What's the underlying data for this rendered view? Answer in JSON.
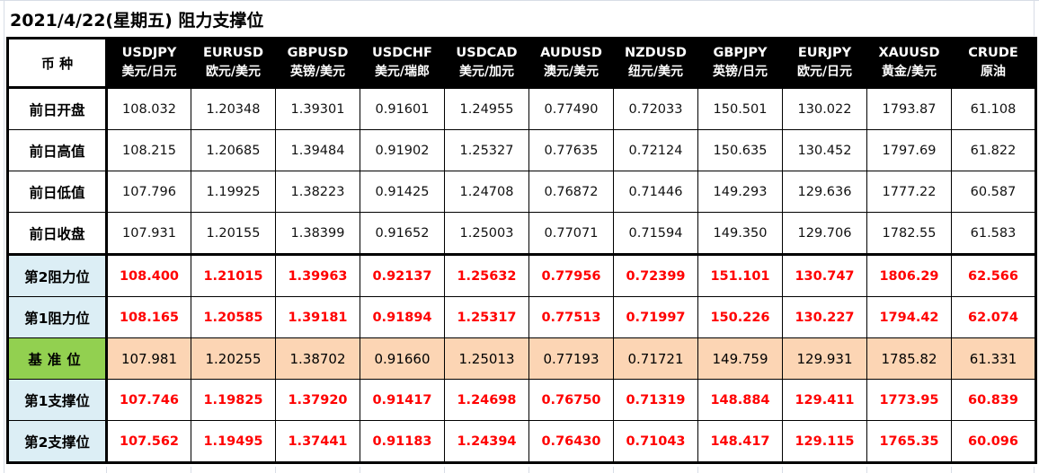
{
  "title": "2021/4/22(星期五) 阻力支撑位",
  "corner_label": "币 种",
  "columns": [
    {
      "code": "USDJPY",
      "name": "美元/日元"
    },
    {
      "code": "EURUSD",
      "name": "欧元/美元"
    },
    {
      "code": "GBPUSD",
      "name": "英镑/美元"
    },
    {
      "code": "USDCHF",
      "name": "美元/瑞郎"
    },
    {
      "code": "USDCAD",
      "name": "美元/加元"
    },
    {
      "code": "AUDUSD",
      "name": "澳元/美元"
    },
    {
      "code": "NZDUSD",
      "name": "纽元/美元"
    },
    {
      "code": "GBPJPY",
      "name": "英镑/日元"
    },
    {
      "code": "EURJPY",
      "name": "欧元/日元"
    },
    {
      "code": "XAUUSD",
      "name": "黄金/美元"
    },
    {
      "code": "CRUDE",
      "name": "原油"
    }
  ],
  "rows": [
    {
      "label": "前日开盘",
      "kind": "hist",
      "values": [
        "108.032",
        "1.20348",
        "1.39301",
        "0.91601",
        "1.24955",
        "0.77490",
        "0.72033",
        "150.501",
        "130.022",
        "1793.87",
        "61.108"
      ]
    },
    {
      "label": "前日高值",
      "kind": "hist",
      "values": [
        "108.215",
        "1.20685",
        "1.39484",
        "0.91902",
        "1.25327",
        "0.77635",
        "0.72124",
        "150.635",
        "130.452",
        "1797.69",
        "61.822"
      ]
    },
    {
      "label": "前日低值",
      "kind": "hist",
      "values": [
        "107.796",
        "1.19925",
        "1.38223",
        "0.91425",
        "1.24708",
        "0.76872",
        "0.71446",
        "149.293",
        "129.636",
        "1777.22",
        "60.587"
      ]
    },
    {
      "label": "前日收盘",
      "kind": "hist",
      "values": [
        "107.931",
        "1.20155",
        "1.38399",
        "0.91652",
        "1.25003",
        "0.77071",
        "0.71594",
        "149.350",
        "129.706",
        "1782.55",
        "61.583"
      ]
    },
    {
      "label": "第2阻力位",
      "kind": "level",
      "values": [
        "108.400",
        "1.21015",
        "1.39963",
        "0.92137",
        "1.25632",
        "0.77956",
        "0.72399",
        "151.101",
        "130.747",
        "1806.29",
        "62.566"
      ]
    },
    {
      "label": "第1阻力位",
      "kind": "level",
      "values": [
        "108.165",
        "1.20585",
        "1.39181",
        "0.91894",
        "1.25317",
        "0.77513",
        "0.71997",
        "150.226",
        "130.227",
        "1794.42",
        "62.074"
      ]
    },
    {
      "label": "基准位",
      "kind": "pivot",
      "values": [
        "107.981",
        "1.20255",
        "1.38702",
        "0.91660",
        "1.25013",
        "0.77193",
        "0.71721",
        "149.759",
        "129.931",
        "1785.82",
        "61.331"
      ]
    },
    {
      "label": "第1支撑位",
      "kind": "level",
      "values": [
        "107.746",
        "1.19825",
        "1.37920",
        "0.91417",
        "1.24698",
        "0.76750",
        "0.71319",
        "148.884",
        "129.411",
        "1773.95",
        "60.839"
      ]
    },
    {
      "label": "第2支撑位",
      "kind": "level",
      "values": [
        "107.562",
        "1.19495",
        "1.37441",
        "0.91183",
        "1.24394",
        "0.76430",
        "0.71043",
        "148.417",
        "129.115",
        "1765.35",
        "60.096"
      ]
    }
  ],
  "colors": {
    "header_bg": "#000000",
    "header_text": "#ffffff",
    "level_text": "#ff0000",
    "level_label_bg": "#dceef5",
    "pivot_label_bg": "#92d050",
    "pivot_row_bg": "#fcd5b4"
  }
}
